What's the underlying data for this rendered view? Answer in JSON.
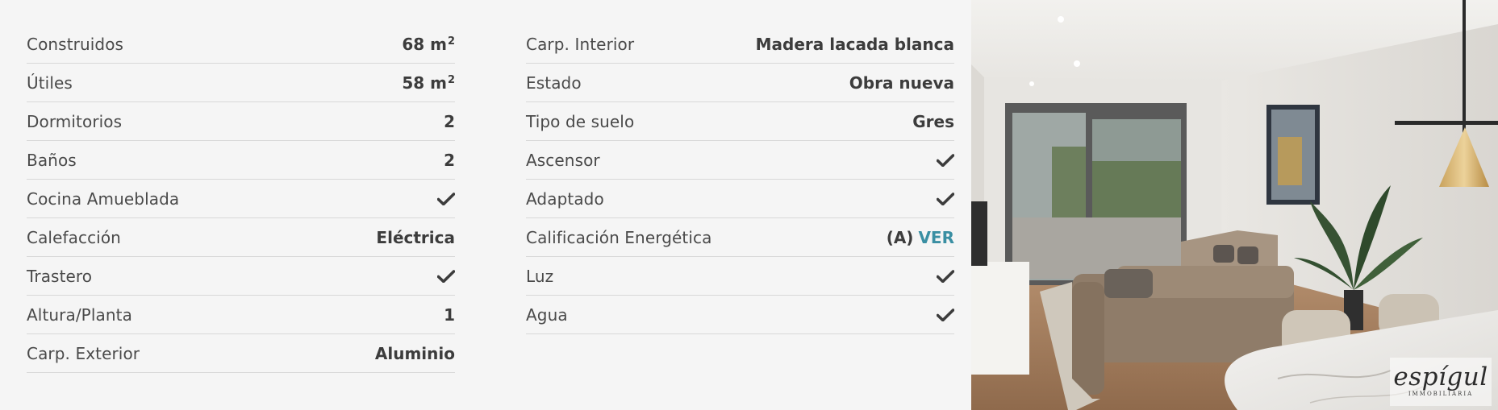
{
  "features_left": [
    {
      "label": "Construidos",
      "value": "68 m",
      "sup": "2",
      "check": false
    },
    {
      "label": "Útiles",
      "value": "58 m",
      "sup": "2",
      "check": false
    },
    {
      "label": "Dormitorios",
      "value": "2",
      "sup": "",
      "check": false
    },
    {
      "label": "Baños",
      "value": "2",
      "sup": "",
      "check": false
    },
    {
      "label": "Cocina Amueblada",
      "value": "",
      "sup": "",
      "check": true
    },
    {
      "label": "Calefacción",
      "value": "Eléctrica",
      "sup": "",
      "check": false
    },
    {
      "label": "Trastero",
      "value": "",
      "sup": "",
      "check": true
    },
    {
      "label": "Altura/Planta",
      "value": "1",
      "sup": "",
      "check": false
    },
    {
      "label": "Carp. Exterior",
      "value": "Aluminio",
      "sup": "",
      "check": false
    }
  ],
  "features_right": [
    {
      "label": "Carp. Interior",
      "value": "Madera lacada blanca",
      "check": false
    },
    {
      "label": "Estado",
      "value": "Obra nueva",
      "check": false
    },
    {
      "label": "Tipo de suelo",
      "value": "Gres",
      "check": false
    },
    {
      "label": "Ascensor",
      "value": "",
      "check": true
    },
    {
      "label": "Adaptado",
      "value": "",
      "check": true
    },
    {
      "label": "Calificación Energética",
      "value": "(A)",
      "link": "VER",
      "check": false
    },
    {
      "label": "Luz",
      "value": "",
      "check": true
    },
    {
      "label": "Agua",
      "value": "",
      "check": true
    }
  ],
  "logo": {
    "name": "espígul",
    "subtitle": "IMMOBILIÀRIA"
  },
  "colors": {
    "panel_bg": "#f5f5f5",
    "link": "#3a8fa3",
    "text": "#4a4a4a"
  },
  "icons": {
    "check": "check-icon"
  }
}
